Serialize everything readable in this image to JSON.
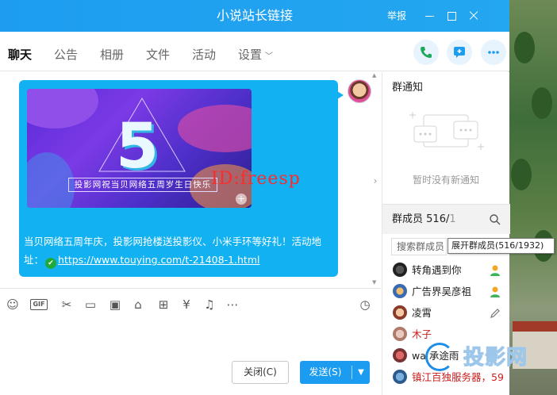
{
  "window": {
    "title": "小说站长链接",
    "report_label": "举报"
  },
  "tabs": [
    {
      "label": "聊天"
    },
    {
      "label": "公告"
    },
    {
      "label": "相册"
    },
    {
      "label": "文件"
    },
    {
      "label": "活动"
    },
    {
      "label": "设置"
    }
  ],
  "chat": {
    "poster_number": "5",
    "poster_caption": "投影网祝当贝网络五周岁生日快乐",
    "watermark_text": "ID:freesp",
    "message_text": "当贝网络五周年庆，投影网抢楼送投影仪、小米手环等好礼！活动地址：",
    "message_link": "https://www.touying.com/t-21408-1.html"
  },
  "buttons": {
    "close": "关闭(C)",
    "send": "发送(S)"
  },
  "notice": {
    "title": "群通知",
    "empty_text": "暂时没有新通知"
  },
  "members": {
    "label": "群成员",
    "count_visible": "516/",
    "count_total_partial": "1",
    "search_placeholder": "搜索群成员",
    "tooltip": "展开群成员(516/1932)",
    "list": [
      {
        "name": "转角遇到你",
        "color": "normal"
      },
      {
        "name": "广告界吴彦祖",
        "color": "normal"
      },
      {
        "name": "凌霄",
        "color": "normal"
      },
      {
        "name": "木子",
        "color": "red"
      },
      {
        "name": "wa 承途雨",
        "color": "normal"
      },
      {
        "name": "镇江百独服务器，59",
        "color": "red"
      }
    ]
  },
  "corner_watermark": "投影网",
  "colors": {
    "accent": "#1e9df0",
    "bubble": "#11b1f2"
  }
}
